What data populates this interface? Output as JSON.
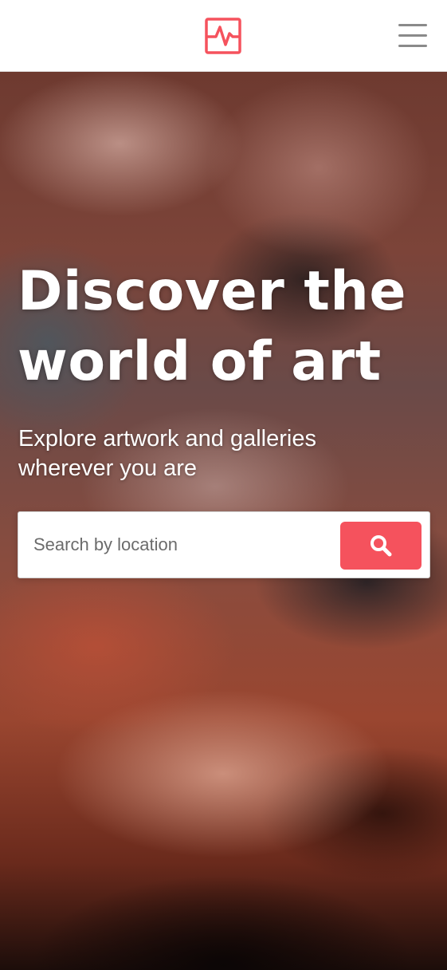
{
  "header": {
    "logo_icon": "pulse-square-logo-icon",
    "menu_icon": "hamburger-menu-icon"
  },
  "hero": {
    "title_lines": [
      "Discover the",
      "world of art"
    ],
    "subtitle_lines": [
      "Explore artwork and galleries",
      "wherever you are"
    ]
  },
  "search": {
    "placeholder": "Search by location",
    "value": "",
    "button_icon": "search-icon"
  },
  "colors": {
    "accent": "#f5525d",
    "header_bg": "#ffffff",
    "menu_icon": "#8a8a8a",
    "hero_text": "#ffffff"
  }
}
